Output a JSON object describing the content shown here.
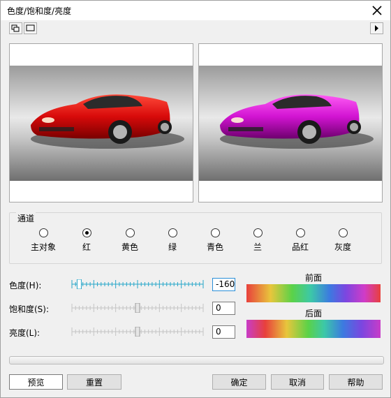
{
  "window": {
    "title": "色度/饱和度/亮度"
  },
  "channel_group": {
    "title": "通道",
    "selected": "红",
    "options": [
      "主对象",
      "红",
      "黄色",
      "绿",
      "青色",
      "兰",
      "品红",
      "灰度"
    ]
  },
  "sliders": {
    "hue": {
      "label": "色度(H):",
      "value": "-160",
      "level": -160
    },
    "saturation": {
      "label": "饱和度(S):",
      "value": "0",
      "level": 0
    },
    "lightness": {
      "label": "亮度(L):",
      "value": "0",
      "level": 0
    }
  },
  "gradients": {
    "before_label": "前面",
    "after_label": "后面"
  },
  "buttons": {
    "preview": "预览",
    "reset": "重置",
    "ok": "确定",
    "cancel": "取消",
    "help": "帮助"
  },
  "colors": {
    "original_car": "#d80a0a",
    "adjusted_car": "#d214d2",
    "focus_border": "#2a8fd8",
    "slider_active": "#26a6c9"
  }
}
